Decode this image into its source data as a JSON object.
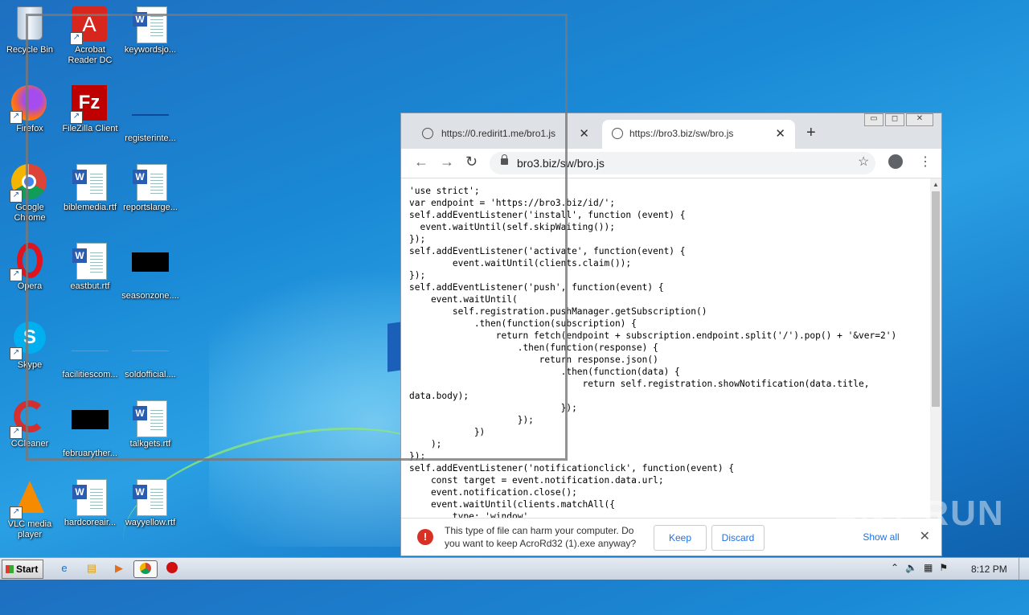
{
  "desktop": {
    "icons": [
      {
        "label": "Recycle Bin",
        "icon": "recycle-bin-icon"
      },
      {
        "label": "Acrobat Reader DC",
        "icon": "acrobat-icon"
      },
      {
        "label": "keywordsjo...",
        "icon": "word-document-icon"
      },
      {
        "label": "Firefox",
        "icon": "firefox-icon"
      },
      {
        "label": "FileZilla Client",
        "icon": "filezilla-icon"
      },
      {
        "label": "registerinte...",
        "icon": "blank-file-icon"
      },
      {
        "label": "Google Chrome",
        "icon": "chrome-icon"
      },
      {
        "label": "biblemedia.rtf",
        "icon": "word-document-icon"
      },
      {
        "label": "reportslarge...",
        "icon": "word-document-icon"
      },
      {
        "label": "Opera",
        "icon": "opera-icon"
      },
      {
        "label": "eastbut.rtf",
        "icon": "word-document-icon"
      },
      {
        "label": "seasonzone....",
        "icon": "black-file-icon"
      },
      {
        "label": "Skype",
        "icon": "skype-icon"
      },
      {
        "label": "facilitiescom...",
        "icon": "blank-file-icon"
      },
      {
        "label": "soldofficial....",
        "icon": "blank-file-icon"
      },
      {
        "label": "CCleaner",
        "icon": "ccleaner-icon"
      },
      {
        "label": "februaryther...",
        "icon": "black-file-icon"
      },
      {
        "label": "talkgets.rtf",
        "icon": "word-document-icon"
      },
      {
        "label": "VLC media player",
        "icon": "vlc-icon"
      },
      {
        "label": "hardcoreair...",
        "icon": "word-document-icon"
      },
      {
        "label": "wayyellow.rtf",
        "icon": "word-document-icon"
      }
    ]
  },
  "browser": {
    "tabs": [
      {
        "title": "https://0.redirit1.me/bro1.js",
        "active": false
      },
      {
        "title": "https://bro3.biz/sw/bro.js",
        "active": true
      }
    ],
    "new_tab": "+",
    "window_buttons": [
      "▭",
      "◻",
      "✕"
    ],
    "url": "bro3.biz/sw/bro.js",
    "code": "'use strict';\nvar endpoint = 'https://bro3.biz/id/';\nself.addEventListener('install', function (event) {\n  event.waitUntil(self.skipWaiting());\n});\nself.addEventListener('activate', function(event) {\n        event.waitUntil(clients.claim());\n});\nself.addEventListener('push', function(event) {\n    event.waitUntil(\n        self.registration.pushManager.getSubscription()\n            .then(function(subscription) {\n                return fetch(endpoint + subscription.endpoint.split('/').pop() + '&ver=2')\n                    .then(function(response) {\n                        return response.json()\n                            .then(function(data) {\n                                return self.registration.showNotification(data.title,\ndata.body);\n                            });\n                    });\n            })\n    );\n});\nself.addEventListener('notificationclick', function(event) {\n    const target = event.notification.data.url;\n    event.notification.close();\n    event.waitUntil(clients.matchAll({\n        type: 'window',",
    "download": {
      "message": "This type of file can harm your computer. Do you want to keep AcroRd32 (1).exe anyway?",
      "keep": "Keep",
      "discard": "Discard",
      "show_all": "Show all"
    }
  },
  "watermark": "ANY RUN",
  "taskbar": {
    "start": "Start",
    "clock": "8:12 PM"
  }
}
